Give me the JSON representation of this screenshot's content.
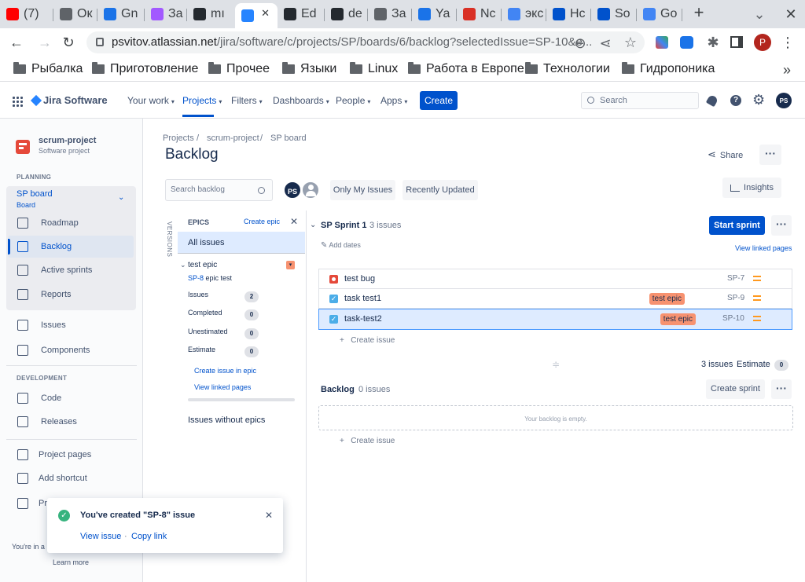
{
  "browser": {
    "tabs": [
      {
        "label": "(7)",
        "fav": "youtube-icon",
        "color": "#ff0000"
      },
      {
        "label": "Ок",
        "fav": "globe-icon",
        "color": "#5f6368"
      },
      {
        "label": "Gn",
        "fav": "mail-icon",
        "color": "#1a73e8"
      },
      {
        "label": "За",
        "fav": "figma-icon",
        "color": "#a259ff"
      },
      {
        "label": "mı",
        "fav": "github-icon",
        "color": "#24292f"
      },
      {
        "label": "",
        "fav": "jira-icon",
        "color": "#2684ff"
      },
      {
        "label": "Ed",
        "fav": "github-icon",
        "color": "#24292f"
      },
      {
        "label": "de",
        "fav": "github-icon",
        "color": "#24292f"
      },
      {
        "label": "За",
        "fav": "globe-icon",
        "color": "#5f6368"
      },
      {
        "label": "Ya",
        "fav": "yc-icon",
        "color": "#1a73e8"
      },
      {
        "label": "Nc",
        "fav": "nc-icon",
        "color": "#d93025"
      },
      {
        "label": "экс",
        "fav": "google-icon",
        "color": "#4285f4"
      },
      {
        "label": "Hc",
        "fav": "atlassian-icon",
        "color": "#0052cc"
      },
      {
        "label": "So",
        "fav": "atlassian-icon",
        "color": "#0052cc"
      },
      {
        "label": "Go",
        "fav": "translate-icon",
        "color": "#4285f4"
      }
    ],
    "url_host": "psvitov.atlassian.net",
    "url_path": "/jira/software/c/projects/SP/boards/6/backlog?selectedIssue=SP-10&e...",
    "profile_initial": "P",
    "bookmarks": [
      "Рыбалка",
      "Приготовление",
      "Прочее",
      "Языки",
      "Linux",
      "Работа в Европе",
      "Технологии",
      "Гидропоника"
    ]
  },
  "jira": {
    "product": "Jira Software",
    "nav": [
      "Your work",
      "Projects",
      "Filters",
      "Dashboards",
      "People",
      "Apps"
    ],
    "create": "Create",
    "search_placeholder": "Search",
    "user_initials": "PS"
  },
  "sidebar": {
    "project_name": "scrum-project",
    "project_type": "Software project",
    "planning": "PLANNING",
    "board_name": "SP board",
    "board_type": "Board",
    "planning_items": [
      "Roadmap",
      "Backlog",
      "Active sprints",
      "Reports"
    ],
    "other_items": [
      "Issues",
      "Components"
    ],
    "development": "DEVELOPMENT",
    "dev_items": [
      "Code",
      "Releases"
    ],
    "bottom_items": [
      "Project pages",
      "Add shortcut",
      "Pr"
    ],
    "footer_text": "You're in a",
    "learn_more": "Learn more"
  },
  "main": {
    "breadcrumb": [
      "Projects",
      "scrum-project",
      "SP board"
    ],
    "title": "Backlog",
    "share": "Share",
    "search_placeholder": "Search backlog",
    "avatar_initials": "PS",
    "filters": [
      "Only My Issues",
      "Recently Updated"
    ],
    "insights": "Insights",
    "versions": "VERSIONS"
  },
  "epics_panel": {
    "title": "EPICS",
    "create_epic": "Create epic",
    "all_issues": "All issues",
    "epic_name": "test epic",
    "epic_key": "SP-8",
    "epic_summary": "epic test",
    "stats": [
      {
        "label": "Issues",
        "value": "2"
      },
      {
        "label": "Completed",
        "value": "0"
      },
      {
        "label": "Unestimated",
        "value": "0"
      },
      {
        "label": "Estimate",
        "value": "0"
      }
    ],
    "create_issue_in_epic": "Create issue in epic",
    "view_linked_pages": "View linked pages",
    "issues_without_epics": "Issues without epics"
  },
  "sprint": {
    "name": "SP Sprint 1",
    "count": "3 issues",
    "add_dates": "Add dates",
    "start": "Start sprint",
    "view_linked_pages": "View linked pages",
    "issues": [
      {
        "title": "test bug",
        "key": "SP-7",
        "epic": "",
        "type": "bug"
      },
      {
        "title": "task test1",
        "key": "SP-9",
        "epic": "test epic",
        "type": "task"
      },
      {
        "title": "task-test2",
        "key": "SP-10",
        "epic": "test epic",
        "type": "task"
      }
    ],
    "create_issue": "Create issue",
    "summary_count": "3 issues",
    "estimate_label": "Estimate",
    "estimate_value": "0"
  },
  "backlog": {
    "name": "Backlog",
    "count": "0 issues",
    "create_sprint": "Create sprint",
    "empty": "Your backlog is empty.",
    "create_issue": "Create issue"
  },
  "toast": {
    "message": "You've created \"SP-8\" issue",
    "view": "View issue",
    "dot": "·",
    "copy": "Copy link"
  },
  "colors": {
    "brand": "#0052cc",
    "epic": "#f79270",
    "bug": "#e5493a",
    "task": "#4bade8",
    "priority": "#ff991f",
    "success": "#36b37e"
  }
}
